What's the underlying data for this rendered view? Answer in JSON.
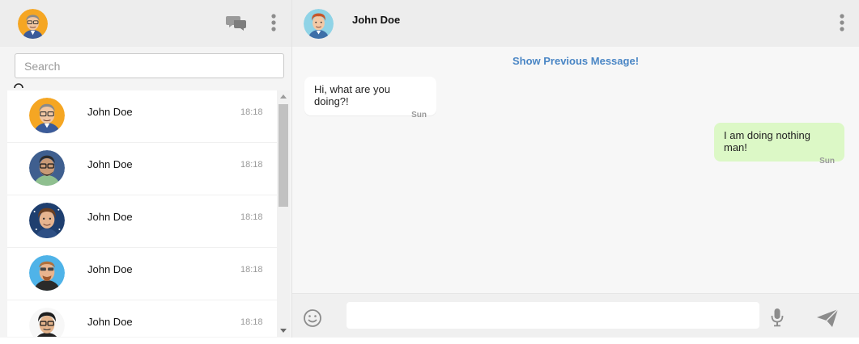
{
  "user": {
    "avatar": "user-avatar-glasses"
  },
  "left_header": {
    "icons": [
      "chat-bubbles-icon",
      "vertical-dots-menu-icon"
    ]
  },
  "search": {
    "placeholder": "Search",
    "value": ""
  },
  "contacts": [
    {
      "name": "John Doe",
      "time": "18:18",
      "avatar": "avatar-orange-glasses"
    },
    {
      "name": "John Doe",
      "time": "18:18",
      "avatar": "avatar-blue-glasses"
    },
    {
      "name": "John Doe",
      "time": "18:18",
      "avatar": "avatar-navy-stars"
    },
    {
      "name": "John Doe",
      "time": "18:18",
      "avatar": "avatar-sky-beard"
    },
    {
      "name": "John Doe",
      "time": "18:18",
      "avatar": "avatar-white-glasses"
    }
  ],
  "conversation": {
    "name": "John Doe",
    "avatar": "avatar-teal-redhair",
    "show_previous": "Show Previous Message!",
    "messages": [
      {
        "direction": "incoming",
        "text": "Hi, what are you doing?!",
        "day": "Sun"
      },
      {
        "direction": "outgoing",
        "text": "I am doing nothing man!",
        "day": "Sun"
      }
    ]
  },
  "composer": {
    "value": "",
    "placeholder": "",
    "icons": [
      "emoji-icon",
      "microphone-icon",
      "send-icon"
    ]
  },
  "colors": {
    "header_bg": "#ededed",
    "link": "#4a86c5",
    "outgoing_bubble": "#dcf8c6",
    "incoming_bubble": "#ffffff"
  }
}
